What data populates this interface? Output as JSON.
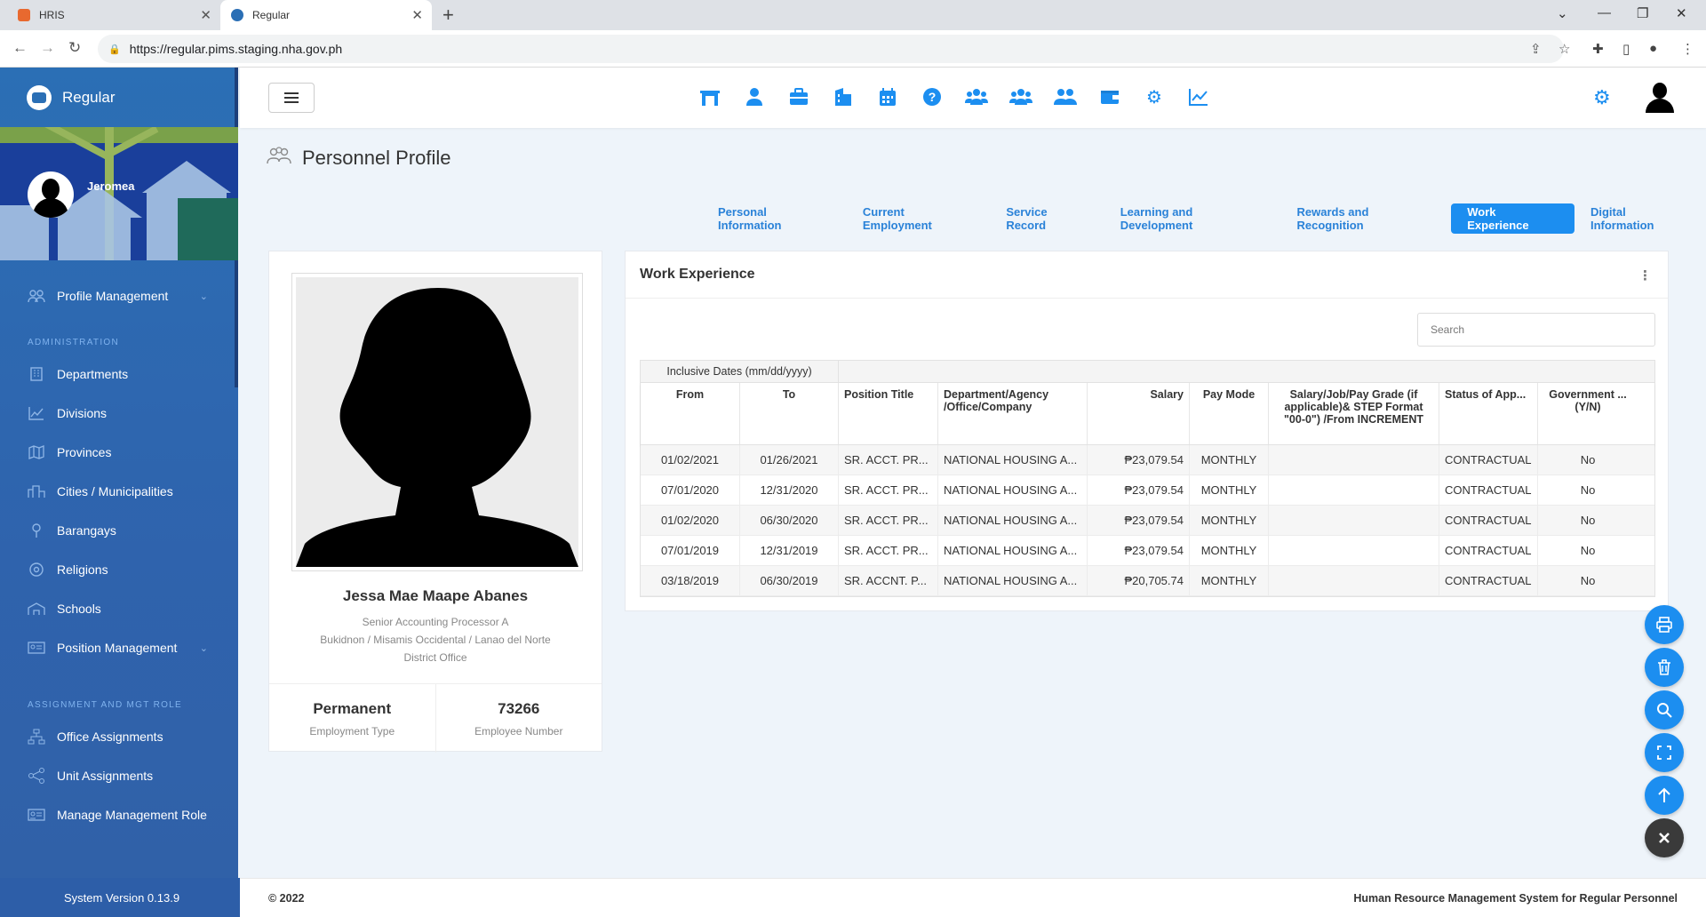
{
  "browser": {
    "tabs": [
      {
        "title": "HRIS",
        "favicon_color": "#e8692f"
      },
      {
        "title": "Regular",
        "favicon_color": "#2b6fb5"
      }
    ],
    "url": "https://regular.pims.staging.nha.gov.ph"
  },
  "sidebar": {
    "brand": "Regular",
    "username": "Jeromea",
    "items_main": [
      {
        "label": "Profile Management",
        "icon": "users-icon",
        "has_chevron": true
      }
    ],
    "section_admin": "ADMINISTRATION",
    "items_admin": [
      {
        "label": "Departments",
        "icon": "building-icon"
      },
      {
        "label": "Divisions",
        "icon": "chart-icon"
      },
      {
        "label": "Provinces",
        "icon": "map-icon"
      },
      {
        "label": "Cities / Municipalities",
        "icon": "city-icon"
      },
      {
        "label": "Barangays",
        "icon": "pin-icon"
      },
      {
        "label": "Religions",
        "icon": "religion-icon"
      },
      {
        "label": "Schools",
        "icon": "school-icon"
      },
      {
        "label": "Position Management",
        "icon": "position-icon",
        "has_chevron": true
      }
    ],
    "section_assign": "ASSIGNMENT AND MGT ROLE",
    "items_assign": [
      {
        "label": "Office Assignments",
        "icon": "sitemap-icon"
      },
      {
        "label": "Unit Assignments",
        "icon": "nodes-icon"
      },
      {
        "label": "Manage Management Role",
        "icon": "id-card-icon"
      }
    ],
    "version": "System Version 0.13.9"
  },
  "page": {
    "title": "Personnel Profile",
    "tabs": [
      {
        "label": "Personal Information",
        "active": false
      },
      {
        "label": "Current Employment",
        "active": false
      },
      {
        "label": "Service Record",
        "active": false
      },
      {
        "label": "Learning and Development",
        "active": false
      },
      {
        "label": "Rewards and Recognition",
        "active": false
      },
      {
        "label": "Work Experience",
        "active": true
      },
      {
        "label": "Digital Information",
        "active": false
      }
    ]
  },
  "profile": {
    "name": "Jessa Mae Maape Abanes",
    "position": "Senior Accounting Processor A",
    "office_line1": "Bukidnon / Misamis Occidental / Lanao del Norte",
    "office_line2": "District Office",
    "employment_type": "Permanent",
    "employment_type_label": "Employment Type",
    "employee_number": "73266",
    "employee_number_label": "Employee Number"
  },
  "work_experience": {
    "title": "Work Experience",
    "search_placeholder": "Search",
    "group_header": "Inclusive Dates (mm/dd/yyyy)",
    "columns": [
      "From",
      "To",
      "Position Title",
      "Department/Agency /Office/Company",
      "Salary",
      "Pay Mode",
      "Salary/Job/Pay Grade (if applicable)& STEP Format \"00-0\") /From INCREMENT",
      "Status of App...",
      "Government ... (Y/N)"
    ],
    "rows": [
      [
        "01/02/2021",
        "01/26/2021",
        "SR. ACCT. PR...",
        "NATIONAL HOUSING A...",
        "₱23,079.54",
        "MONTHLY",
        "",
        "CONTRACTUAL",
        "No"
      ],
      [
        "07/01/2020",
        "12/31/2020",
        "SR. ACCT. PR...",
        "NATIONAL HOUSING A...",
        "₱23,079.54",
        "MONTHLY",
        "",
        "CONTRACTUAL",
        "No"
      ],
      [
        "01/02/2020",
        "06/30/2020",
        "SR. ACCT. PR...",
        "NATIONAL HOUSING A...",
        "₱23,079.54",
        "MONTHLY",
        "",
        "CONTRACTUAL",
        "No"
      ],
      [
        "07/01/2019",
        "12/31/2019",
        "SR. ACCT. PR...",
        "NATIONAL HOUSING A...",
        "₱23,079.54",
        "MONTHLY",
        "",
        "CONTRACTUAL",
        "No"
      ],
      [
        "03/18/2019",
        "06/30/2019",
        "SR. ACCNT. P...",
        "NATIONAL HOUSING A...",
        "₱20,705.74",
        "MONTHLY",
        "",
        "CONTRACTUAL",
        "No"
      ]
    ]
  },
  "fabs": [
    {
      "name": "print-button",
      "icon": "print-icon"
    },
    {
      "name": "delete-button",
      "icon": "trash-icon"
    },
    {
      "name": "search-button",
      "icon": "search-icon"
    },
    {
      "name": "fullscreen-button",
      "icon": "expand-icon"
    },
    {
      "name": "scroll-top-button",
      "icon": "arrow-up-icon"
    },
    {
      "name": "close-button",
      "icon": "close-icon"
    }
  ],
  "footer": {
    "copyright": "© 2022",
    "system_name": "Human Resource Management System for Regular Personnel"
  },
  "colors": {
    "accent": "#1c8ef0",
    "sidebar": "#2b6fb5",
    "page_bg": "#eef4fa"
  }
}
